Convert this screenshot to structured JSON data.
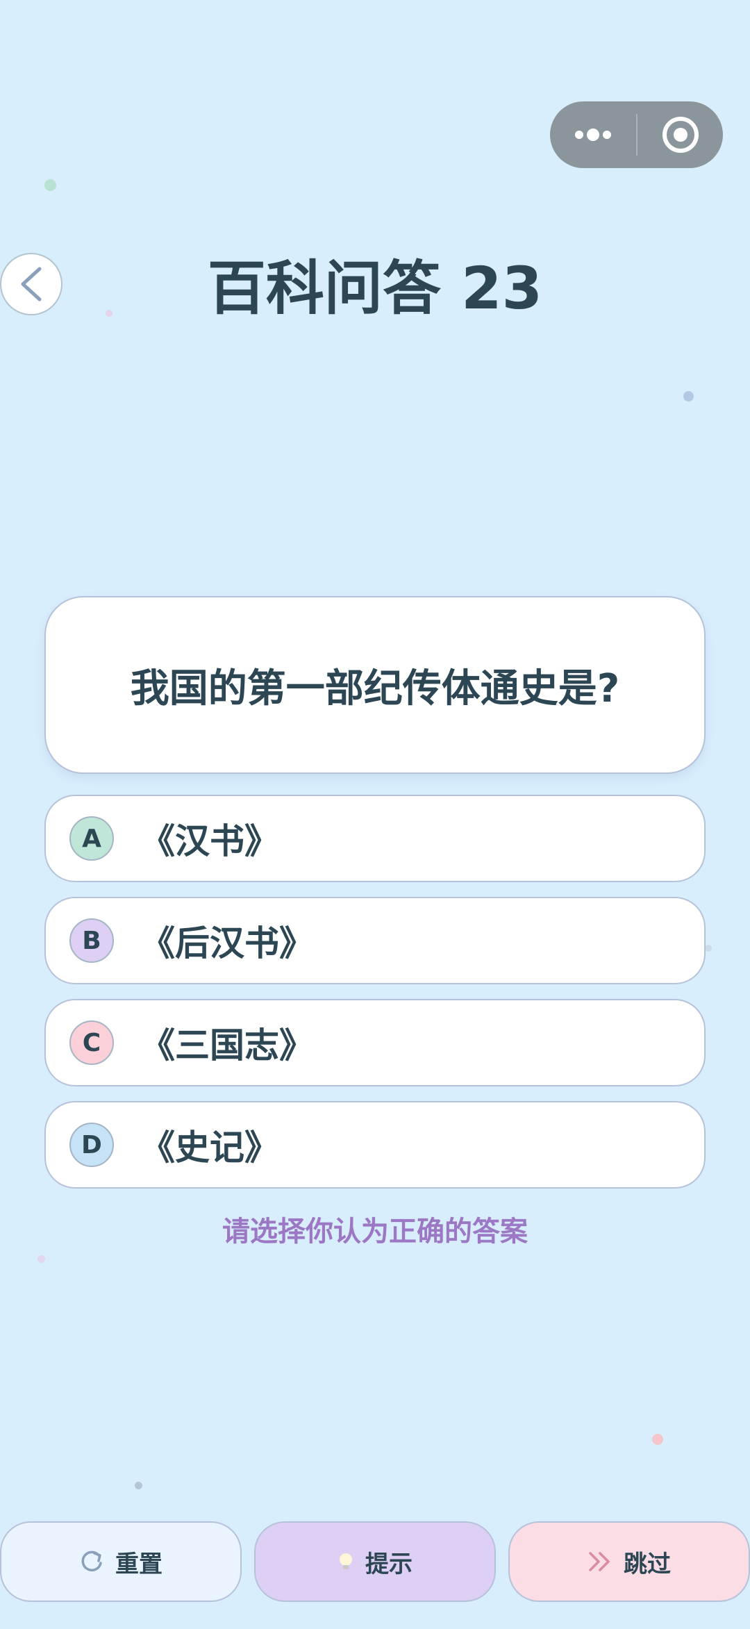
{
  "header": {
    "title": "百科问答 23",
    "back_icon": "chevron-left-icon",
    "capsule_more_icon": "more-dots-icon",
    "capsule_close_icon": "target-circle-icon"
  },
  "question": {
    "text": "我国的第一部纪传体通史是?"
  },
  "options": [
    {
      "letter": "A",
      "text": "《汉书》",
      "color": "#bfe6d8"
    },
    {
      "letter": "B",
      "text": "《后汉书》",
      "color": "#ddd0f4"
    },
    {
      "letter": "C",
      "text": "《三国志》",
      "color": "#fbd0d8"
    },
    {
      "letter": "D",
      "text": "《史记》",
      "color": "#c6e2f6"
    }
  ],
  "prompt": "请选择你认为正确的答案",
  "footer": {
    "reset_label": "重置",
    "reset_icon": "refresh-icon",
    "hint_label": "提示",
    "hint_icon": "lightbulb-icon",
    "skip_label": "跳过",
    "skip_icon": "double-chevron-right-icon"
  },
  "colors": {
    "background": "#d9eefd",
    "accent_purple": "#9c78c4",
    "reset_bg": "#eaf4fe",
    "hint_bg": "#ddd0f4",
    "skip_bg": "#fbdde6"
  }
}
